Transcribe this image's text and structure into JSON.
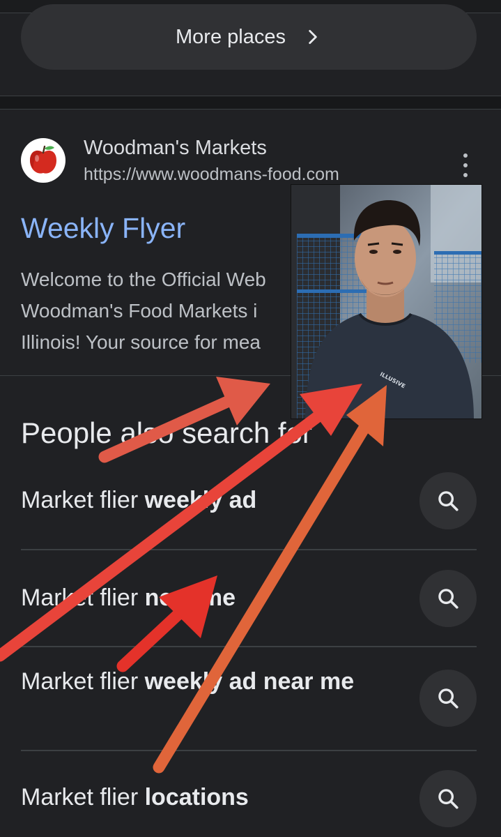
{
  "more_places": {
    "label": "More places",
    "icon": "chevron-right-icon"
  },
  "result": {
    "site_name": "Woodman's Markets",
    "url": "https://www.woodmans-food.com",
    "favicon": "apple-icon",
    "title": "Weekly Flyer",
    "snippet_lines": [
      "Welcome to the Official Web",
      "Woodman's Food Markets i",
      "Illinois! Your source for mea"
    ],
    "menu_icon": "more-vert-icon"
  },
  "overlay_photo": {
    "shirt_text": "ILLUSIVE"
  },
  "people_also_search": {
    "heading": "People also search for",
    "items": [
      {
        "prefix": "Market flier ",
        "bold": "weekly ad",
        "icon": "search-icon"
      },
      {
        "prefix": "Market flier ",
        "bold": "near me",
        "icon": "search-icon"
      },
      {
        "prefix": "Market flier ",
        "bold": "weekly ad near me",
        "icon": "search-icon"
      },
      {
        "prefix": "Market flier ",
        "bold": "locations",
        "icon": "search-icon"
      }
    ]
  },
  "colors": {
    "background": "#202124",
    "link": "#8ab4f8",
    "arrow_red": "#e8443a",
    "arrow_orange": "#e0653a"
  }
}
